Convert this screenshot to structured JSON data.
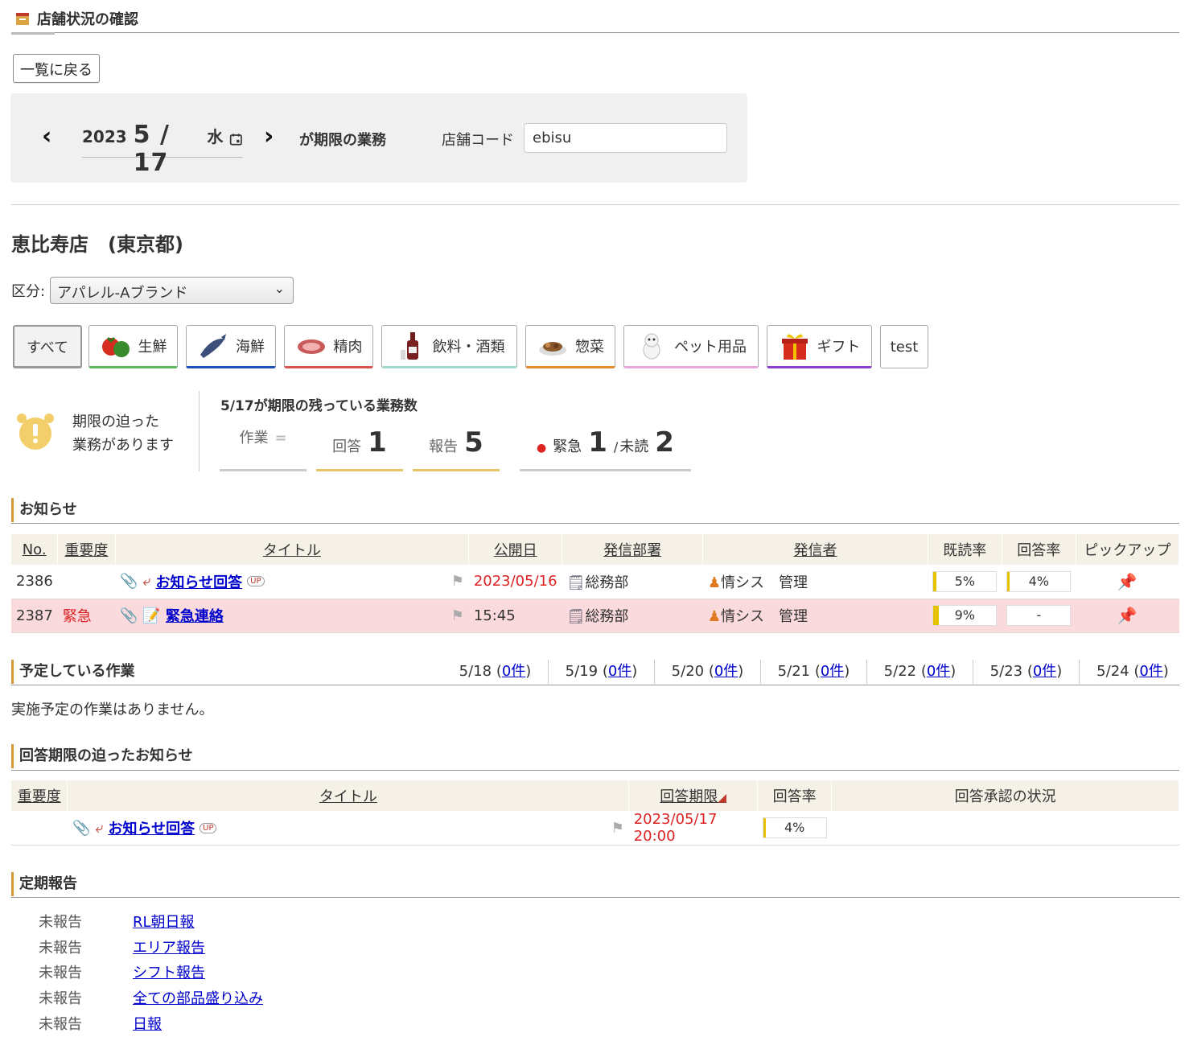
{
  "page": {
    "title": "店舗状況の確認",
    "back_label": "一覧に戻る"
  },
  "date": {
    "year": "2023",
    "month_day": "5 / 17",
    "dow": "水",
    "suffix": "が期限の業務",
    "store_code_label": "店舗コード",
    "store_code_value": "ebisu"
  },
  "store": {
    "name": "恵比寿店　(東京都)"
  },
  "kubun": {
    "label": "区分:",
    "selected": "アパレル-Aブランド"
  },
  "categories": [
    {
      "label": "すべて",
      "color": "#999"
    },
    {
      "label": "生鮮",
      "color": "#5cb85c"
    },
    {
      "label": "海鮮",
      "color": "#1f4fb8"
    },
    {
      "label": "精肉",
      "color": "#d9534f"
    },
    {
      "label": "飲料・酒類",
      "color": "#9fd9d0"
    },
    {
      "label": "惣菜",
      "color": "#e58a2e"
    },
    {
      "label": "ペット用品",
      "color": "#e7a6e0"
    },
    {
      "label": "ギフト",
      "color": "#8a3fd1"
    },
    {
      "label": "test",
      "color": "#aaa"
    }
  ],
  "alert": {
    "line1": "期限の迫った",
    "line2": "業務があります"
  },
  "remaining": {
    "title": "5/17が期限の残っている業務数",
    "work_label": "作業",
    "work_value": "=",
    "answer_label": "回答",
    "answer_value": "1",
    "report_label": "報告",
    "report_value": "5",
    "urgent_label": "緊急",
    "urgent_value": "1",
    "sep": "/",
    "unread_label": "未読",
    "unread_value": "2"
  },
  "notices": {
    "heading": "お知らせ",
    "headers": [
      "No.",
      "重要度",
      "タイトル",
      "公開日",
      "発信部署",
      "発信者",
      "既読率",
      "回答率",
      "ピックアップ"
    ],
    "rows": [
      {
        "no": "2386",
        "priority": "",
        "title": "お知らせ回答",
        "date": "2023/05/16",
        "dept": "総務部",
        "sender": "情シス　管理",
        "read": "5%",
        "read_pct": 5,
        "answer": "4%",
        "answer_pct": 4
      },
      {
        "no": "2387",
        "priority": "緊急",
        "title": "緊急連絡",
        "date": "15:45",
        "dept": "総務部",
        "sender": "情シス　管理",
        "read": "9%",
        "read_pct": 9,
        "answer": "-",
        "answer_pct": 0
      }
    ]
  },
  "schedule": {
    "heading": "予定している作業",
    "days": [
      {
        "d": "5/18",
        "c": "0件"
      },
      {
        "d": "5/19",
        "c": "0件"
      },
      {
        "d": "5/20",
        "c": "0件"
      },
      {
        "d": "5/21",
        "c": "0件"
      },
      {
        "d": "5/22",
        "c": "0件"
      },
      {
        "d": "5/23",
        "c": "0件"
      },
      {
        "d": "5/24",
        "c": "0件"
      }
    ],
    "empty": "実施予定の作業はありません。"
  },
  "deadline": {
    "heading": "回答期限の迫ったお知らせ",
    "headers": [
      "重要度",
      "タイトル",
      "回答期限",
      "回答率",
      "回答承認の状況"
    ],
    "rows": [
      {
        "priority": "",
        "title": "お知らせ回答",
        "deadline": "2023/05/17 20:00",
        "answer": "4%",
        "answer_pct": 4,
        "approval": ""
      }
    ]
  },
  "periodic": {
    "heading": "定期報告",
    "items": [
      {
        "status": "未報告",
        "name": "RL朝日報"
      },
      {
        "status": "未報告",
        "name": "エリア報告"
      },
      {
        "status": "未報告",
        "name": "シフト報告"
      },
      {
        "status": "未報告",
        "name": "全ての部品盛り込み"
      },
      {
        "status": "未報告",
        "name": "日報"
      }
    ]
  }
}
